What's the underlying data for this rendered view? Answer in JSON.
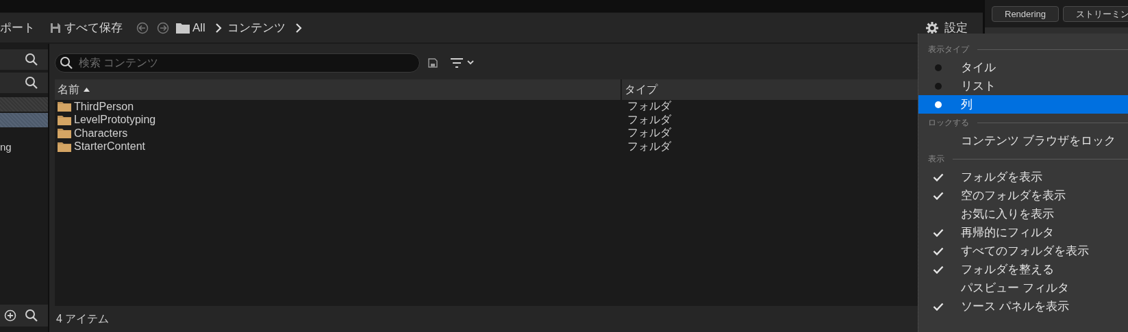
{
  "toolbar": {
    "import_label": "ポート",
    "save_all": "すべて保存",
    "breadcrumbs": [
      "All",
      "コンテンツ"
    ],
    "settings": "設定"
  },
  "right_panel": {
    "buttons": [
      "Rendering",
      "ストリーミン"
    ]
  },
  "sources": {
    "rows": [
      {
        "selected": false
      },
      {
        "selected": true
      }
    ],
    "partial_item": "ng"
  },
  "search": {
    "placeholder": "検索 コンテンツ"
  },
  "table": {
    "columns": [
      {
        "label": "名前",
        "sorted": true
      },
      {
        "label": "タイプ",
        "sorted": false
      }
    ],
    "rows": [
      {
        "name": "ThirdPerson",
        "type": "フォルダ"
      },
      {
        "name": "LevelPrototyping",
        "type": "フォルダ"
      },
      {
        "name": "Characters",
        "type": "フォルダ"
      },
      {
        "name": "StarterContent",
        "type": "フォルダ"
      }
    ]
  },
  "status_bar": "4 アイテム",
  "settings_menu": {
    "sections": [
      {
        "heading": "表示タイプ",
        "items": [
          {
            "kind": "radio",
            "label": "タイル",
            "selected": false
          },
          {
            "kind": "radio",
            "label": "リスト",
            "selected": false
          },
          {
            "kind": "radio",
            "label": "列",
            "selected": true
          }
        ]
      },
      {
        "heading": "ロックする",
        "items": [
          {
            "kind": "action",
            "label": "コンテンツ ブラウザをロック"
          }
        ]
      },
      {
        "heading": "表示",
        "items": [
          {
            "kind": "check",
            "label": "フォルダを表示",
            "checked": true
          },
          {
            "kind": "check",
            "label": "空のフォルダを表示",
            "checked": true
          },
          {
            "kind": "check",
            "label": "お気に入りを表示",
            "checked": false
          },
          {
            "kind": "check",
            "label": "再帰的にフィルタ",
            "checked": true
          },
          {
            "kind": "check",
            "label": "すべてのフォルダを表示",
            "checked": true
          },
          {
            "kind": "check",
            "label": "フォルダを整える",
            "checked": true
          },
          {
            "kind": "check",
            "label": "パスビュー フィルタ",
            "checked": false
          },
          {
            "kind": "check",
            "label": "ソース パネルを表示",
            "checked": true
          }
        ]
      }
    ]
  }
}
